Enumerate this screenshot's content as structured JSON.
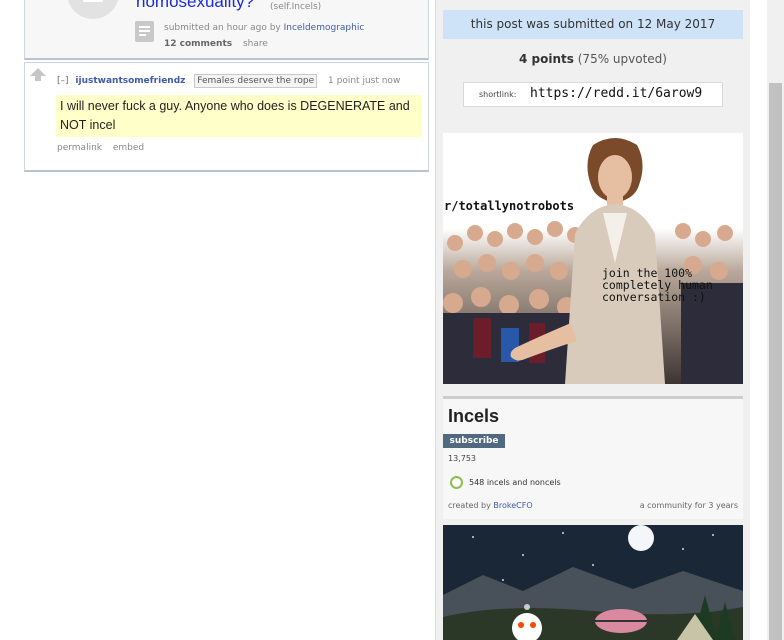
{
  "post": {
    "title": "homosexuality?",
    "domain": "(self.Incels)",
    "tagline_prefix": "submitted an hour ago by",
    "author": "Inceldemographic",
    "comments_label": "12 comments",
    "share_label": "share"
  },
  "comment": {
    "toggle": "[–]",
    "author": "ijustwantsomefriendz",
    "flair": "Females deserve the rope",
    "score_time": "1 point just now",
    "body": "I will never fuck a guy. Anyone who does is DEGENERATE and NOT incel",
    "permalink_label": "permalink",
    "embed_label": "embed"
  },
  "sidebar": {
    "submitted_date": "this post was submitted on 12 May 2017",
    "points": "4 points",
    "upvoted": "(75% upvoted)",
    "shortlink_label": "shortlink:",
    "shortlink_url": "https://redd.it/6arow9",
    "banner": {
      "label": "r/totallynotrobots",
      "caption": "join the 100%\ncompletely human\nconversation :)"
    },
    "subreddit": {
      "name": "Incels",
      "subscribe_label": "subscribe",
      "subscribers": "13,753",
      "online": "548 incels and noncels",
      "created_prefix": "created by",
      "creator": "BrokeCFO",
      "age": "a community for 3 years"
    }
  },
  "colors": {
    "link_blue": "#1b2ad6",
    "author_blue": "#3f5aa8",
    "highlight_yellow": "#ffffc9",
    "date_box": "#cee3f8",
    "subscribe_bg": "#51697f",
    "online_green": "#8cc04a"
  }
}
